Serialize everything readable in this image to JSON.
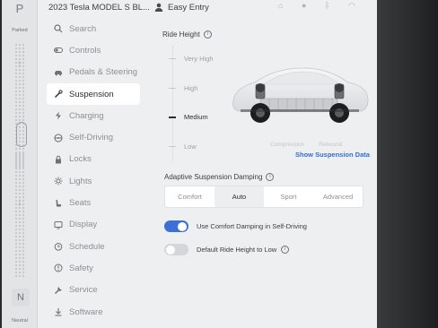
{
  "gear_rail": {
    "park": "P",
    "park_label": "Parked",
    "neutral": "N",
    "neutral_label": "Neutral",
    "up_arrow": "↑",
    "down_arrow": "↓"
  },
  "topbar": {
    "car_name": "2023 Tesla MODEL S BL...",
    "profile_icon": "person-icon",
    "profile_name": "Easy Entry"
  },
  "nav": {
    "items": [
      {
        "label": "Search",
        "icon": "search-icon",
        "active": false
      },
      {
        "label": "Controls",
        "icon": "toggle-icon",
        "active": false
      },
      {
        "label": "Pedals & Steering",
        "icon": "car-icon",
        "active": false
      },
      {
        "label": "Suspension",
        "icon": "wrench-icon",
        "active": true
      },
      {
        "label": "Charging",
        "icon": "bolt-icon",
        "active": false
      },
      {
        "label": "Self-Driving",
        "icon": "steering-wheel-icon",
        "active": false
      },
      {
        "label": "Locks",
        "icon": "lock-icon",
        "active": false
      },
      {
        "label": "Lights",
        "icon": "sun-icon",
        "active": false
      },
      {
        "label": "Seats",
        "icon": "seat-icon",
        "active": false
      },
      {
        "label": "Display",
        "icon": "display-icon",
        "active": false
      },
      {
        "label": "Schedule",
        "icon": "clock-icon",
        "active": false
      },
      {
        "label": "Safety",
        "icon": "shield-icon",
        "active": false
      },
      {
        "label": "Service",
        "icon": "wrench-icon",
        "active": false
      },
      {
        "label": "Software",
        "icon": "download-icon",
        "active": false
      }
    ]
  },
  "ride_height": {
    "title": "Ride Height",
    "levels": [
      "Very High",
      "High",
      "Medium",
      "Low"
    ],
    "selected": "Medium"
  },
  "suspension_data": {
    "compression_label": "Compression",
    "rebound_label": "Rebound",
    "show_data_link": "Show Suspension Data"
  },
  "damping": {
    "title": "Adaptive Suspension Damping",
    "options": [
      "Comfort",
      "Auto",
      "Sport",
      "Advanced"
    ],
    "selected": "Auto"
  },
  "toggles": {
    "comfort_damping_label": "Use Comfort Damping in Self-Driving",
    "comfort_damping_on": true,
    "default_low_label": "Default Ride Height to Low",
    "default_low_on": false
  },
  "colors": {
    "accent": "#3e6fd6",
    "link": "#2f6fd4",
    "background": "#eeeff0"
  }
}
